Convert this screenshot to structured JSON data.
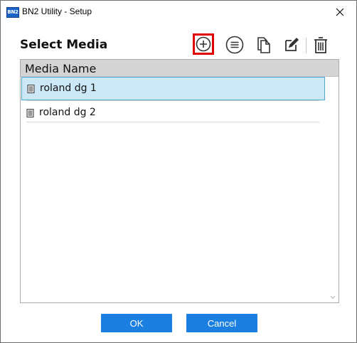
{
  "window": {
    "app_icon_text": "BN2",
    "title": "BN2 Utility - Setup",
    "close_icon": "close-icon"
  },
  "section_title": "Select Media",
  "toolbar": {
    "buttons": [
      {
        "name": "add-media-button",
        "icon": "plus-circle-icon",
        "highlighted": true
      },
      {
        "name": "media-details-button",
        "icon": "list-circle-icon",
        "highlighted": false
      },
      {
        "name": "copy-media-button",
        "icon": "copy-icon",
        "highlighted": false
      },
      {
        "name": "edit-media-button",
        "icon": "edit-icon",
        "highlighted": false
      },
      {
        "name": "delete-media-button",
        "icon": "trash-icon",
        "highlighted": false
      }
    ],
    "highlight_color": "#e00000"
  },
  "list": {
    "header": "Media Name",
    "items": [
      {
        "label": "roland dg 1",
        "selected": true,
        "icon": "media-file-icon"
      },
      {
        "label": "roland dg 2",
        "selected": false,
        "icon": "media-file-icon"
      }
    ]
  },
  "buttons": {
    "ok": "OK",
    "cancel": "Cancel"
  },
  "colors": {
    "accent": "#1a7fe0",
    "selection_bg": "#cce8f6",
    "selection_border": "#4fa6d6",
    "header_bg": "#d4d4d4"
  }
}
